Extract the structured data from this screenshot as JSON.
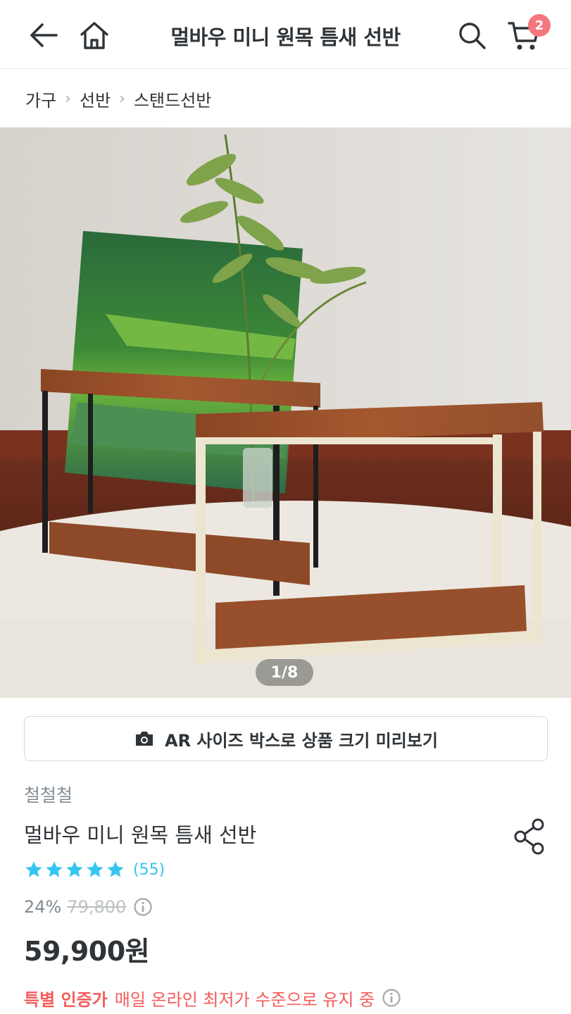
{
  "header": {
    "title": "멀바우 미니 원목 틈새 선반",
    "cart_count": "2",
    "icons": [
      "back-arrow-icon",
      "home-icon",
      "search-icon",
      "cart-icon"
    ]
  },
  "breadcrumb": {
    "items": [
      "가구",
      "선반",
      "스탠드선반"
    ]
  },
  "gallery": {
    "counter": "1/8"
  },
  "ar_button": {
    "label": "AR 사이즈 박스로 상품 크기 미리보기"
  },
  "product": {
    "brand": "철철철",
    "name": "멀바우 미니 원목 틈새 선반",
    "rating": 5,
    "review_count": "(55)",
    "discount": "24%",
    "original_price": "79,800",
    "sale_price": "59,900원",
    "special_tag": "특별 인증가",
    "special_text": "매일 온라인 최저가 수준으로 유지 중"
  },
  "colors": {
    "accent": "#35c5f0",
    "badge": "#f5777e",
    "special": "#f45b5b",
    "text": "#2f3438",
    "muted": "#828c94"
  }
}
